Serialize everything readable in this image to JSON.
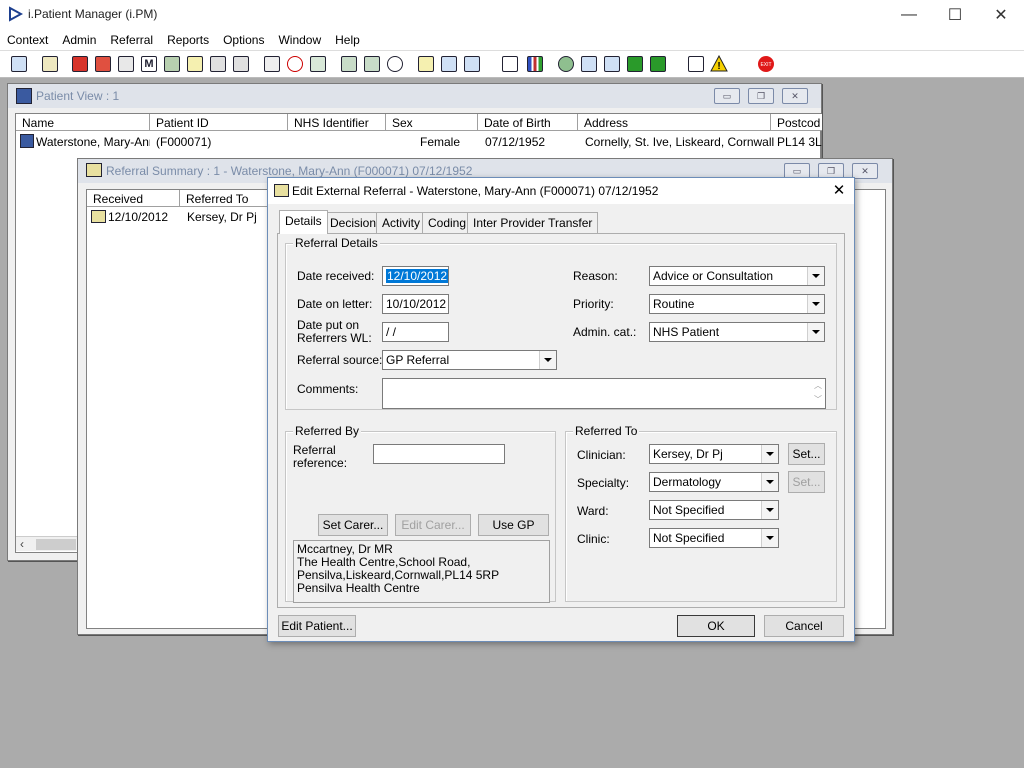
{
  "app": {
    "title": "i.Patient Manager (i.PM)",
    "window_controls": [
      "—",
      "☐",
      "✕"
    ]
  },
  "menu": [
    "Context",
    "Admin",
    "Referral",
    "Reports",
    "Options",
    "Window",
    "Help"
  ],
  "toolbar_icons": [
    "patient-icon",
    "printer-icon",
    "book-icon",
    "referral-icon",
    "form-icon",
    "m-icon",
    "doctor-icon",
    "notes-icon",
    "flag-icon",
    "flag-icon",
    "search-icon",
    "clock-icon",
    "list-icon",
    "card-icon",
    "card-icon",
    "dial-icon",
    "notepad-icon",
    "bed-icon",
    "bed-icon",
    "document-icon",
    "chart-icon",
    "globe-icon",
    "check-icon",
    "check-icon",
    "check-icon",
    "check-icon",
    "swap-icon",
    "warning-icon",
    "exit-icon"
  ],
  "patient_view": {
    "title": "Patient View : 1",
    "columns": [
      "Name",
      "Patient ID",
      "NHS Identifier",
      "Sex",
      "Date of Birth",
      "Address",
      "Postcod"
    ],
    "row": {
      "name": "Waterstone, Mary-Ann",
      "patient_id": "(F000071)",
      "nhs_identifier": "",
      "sex": "Female",
      "dob": "07/12/1952",
      "address": "Cornelly, St. Ive, Liskeard, Cornwall",
      "postcode": "PL14 3L"
    }
  },
  "referral_summary": {
    "title": "Referral Summary : 1 - Waterstone, Mary-Ann (F000071) 07/12/1952",
    "columns": [
      "Received",
      "Referred To"
    ],
    "row": {
      "received": "12/10/2012",
      "referred_to": "Kersey, Dr Pj"
    }
  },
  "dialog": {
    "title": "Edit External Referral - Waterstone, Mary-Ann (F000071) 07/12/1952",
    "close": "✕",
    "tabs": [
      "Details",
      "Decision",
      "Activity",
      "Coding",
      "Inter Provider Transfer"
    ],
    "active_tab": "Details",
    "referral_details": {
      "caption": "Referral Details",
      "date_received_label": "Date received:",
      "date_received": "12/10/2012",
      "date_on_letter_label": "Date on letter:",
      "date_on_letter": "10/10/2012",
      "date_put_on_label_1": "Date put on",
      "date_put_on_label_2": "Referrers WL:",
      "date_put_on": " /  /",
      "referral_source_label": "Referral source:",
      "referral_source": "GP Referral",
      "reason_label": "Reason:",
      "reason": "Advice or Consultation",
      "priority_label": "Priority:",
      "priority": "Routine",
      "admin_cat_label": "Admin. cat.:",
      "admin_cat": "NHS Patient",
      "comments_label": "Comments:",
      "comments": ""
    },
    "referred_by": {
      "caption": "Referred By",
      "reference_label_1": "Referral",
      "reference_label_2": "reference:",
      "reference": "",
      "set_carer": "Set Carer...",
      "edit_carer": "Edit Carer...",
      "use_gp": "Use GP",
      "address_lines": [
        "Mccartney, Dr MR",
        "The Health Centre,School Road,",
        "Pensilva,Liskeard,Cornwall,PL14 5RP",
        "Pensilva Health Centre"
      ]
    },
    "referred_to": {
      "caption": "Referred To",
      "clinician_label": "Clinician:",
      "clinician": "Kersey, Dr Pj",
      "specialty_label": "Specialty:",
      "specialty": "Dermatology",
      "ward_label": "Ward:",
      "ward": "Not Specified",
      "clinic_label": "Clinic:",
      "clinic": "Not Specified",
      "set_label": "Set..."
    },
    "edit_patient": "Edit Patient...",
    "ok": "OK",
    "cancel": "Cancel"
  }
}
